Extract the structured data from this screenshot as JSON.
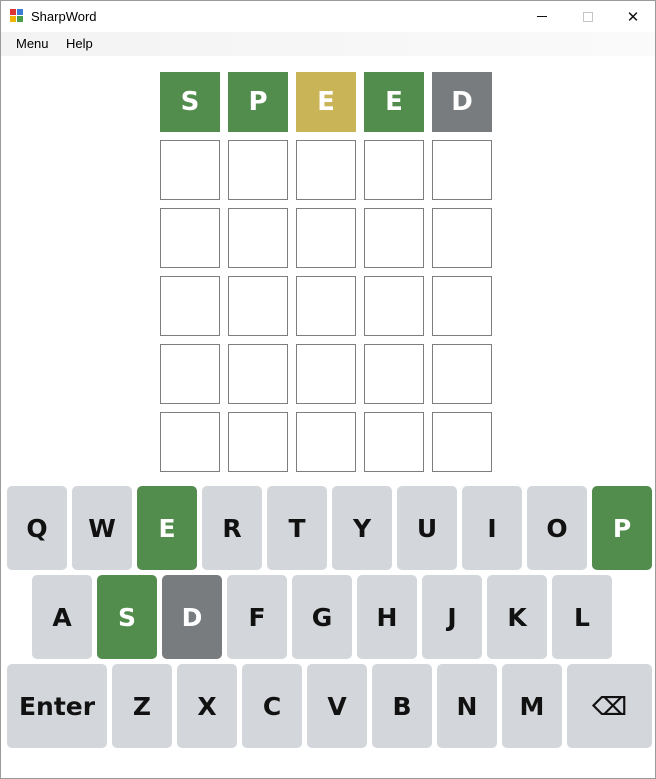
{
  "window": {
    "title": "SharpWord",
    "icon": "app-icon",
    "controls": {
      "minimize_icon": "minimize-icon",
      "maximize_icon": "maximize-icon",
      "close": "✕"
    }
  },
  "menu": {
    "items": [
      "Menu",
      "Help"
    ]
  },
  "colors": {
    "correct": "#538d4e",
    "present": "#c9b458",
    "absent": "#787c7e",
    "key_default": "#d3d6da"
  },
  "board": {
    "rows": [
      [
        {
          "letter": "S",
          "state": "correct"
        },
        {
          "letter": "P",
          "state": "correct"
        },
        {
          "letter": "E",
          "state": "present"
        },
        {
          "letter": "E",
          "state": "correct"
        },
        {
          "letter": "D",
          "state": "absent"
        }
      ],
      [
        {
          "letter": "",
          "state": "empty"
        },
        {
          "letter": "",
          "state": "empty"
        },
        {
          "letter": "",
          "state": "empty"
        },
        {
          "letter": "",
          "state": "empty"
        },
        {
          "letter": "",
          "state": "empty"
        }
      ],
      [
        {
          "letter": "",
          "state": "empty"
        },
        {
          "letter": "",
          "state": "empty"
        },
        {
          "letter": "",
          "state": "empty"
        },
        {
          "letter": "",
          "state": "empty"
        },
        {
          "letter": "",
          "state": "empty"
        }
      ],
      [
        {
          "letter": "",
          "state": "empty"
        },
        {
          "letter": "",
          "state": "empty"
        },
        {
          "letter": "",
          "state": "empty"
        },
        {
          "letter": "",
          "state": "empty"
        },
        {
          "letter": "",
          "state": "empty"
        }
      ],
      [
        {
          "letter": "",
          "state": "empty"
        },
        {
          "letter": "",
          "state": "empty"
        },
        {
          "letter": "",
          "state": "empty"
        },
        {
          "letter": "",
          "state": "empty"
        },
        {
          "letter": "",
          "state": "empty"
        }
      ],
      [
        {
          "letter": "",
          "state": "empty"
        },
        {
          "letter": "",
          "state": "empty"
        },
        {
          "letter": "",
          "state": "empty"
        },
        {
          "letter": "",
          "state": "empty"
        },
        {
          "letter": "",
          "state": "empty"
        }
      ]
    ]
  },
  "keyboard": {
    "rows": [
      [
        {
          "label": "Q",
          "state": "default"
        },
        {
          "label": "W",
          "state": "default"
        },
        {
          "label": "E",
          "state": "correct"
        },
        {
          "label": "R",
          "state": "default"
        },
        {
          "label": "T",
          "state": "default"
        },
        {
          "label": "Y",
          "state": "default"
        },
        {
          "label": "U",
          "state": "default"
        },
        {
          "label": "I",
          "state": "default"
        },
        {
          "label": "O",
          "state": "default"
        },
        {
          "label": "P",
          "state": "correct"
        }
      ],
      [
        {
          "label": "A",
          "state": "default"
        },
        {
          "label": "S",
          "state": "correct"
        },
        {
          "label": "D",
          "state": "absent"
        },
        {
          "label": "F",
          "state": "default"
        },
        {
          "label": "G",
          "state": "default"
        },
        {
          "label": "H",
          "state": "default"
        },
        {
          "label": "J",
          "state": "default"
        },
        {
          "label": "K",
          "state": "default"
        },
        {
          "label": "L",
          "state": "default"
        }
      ],
      [
        {
          "label": "Enter",
          "state": "default",
          "name": "enter-key"
        },
        {
          "label": "Z",
          "state": "default"
        },
        {
          "label": "X",
          "state": "default"
        },
        {
          "label": "C",
          "state": "default"
        },
        {
          "label": "V",
          "state": "default"
        },
        {
          "label": "B",
          "state": "default"
        },
        {
          "label": "N",
          "state": "default"
        },
        {
          "label": "M",
          "state": "default"
        },
        {
          "label": "⌫",
          "state": "default",
          "name": "backspace-key",
          "icon": "backspace-icon"
        }
      ]
    ]
  }
}
